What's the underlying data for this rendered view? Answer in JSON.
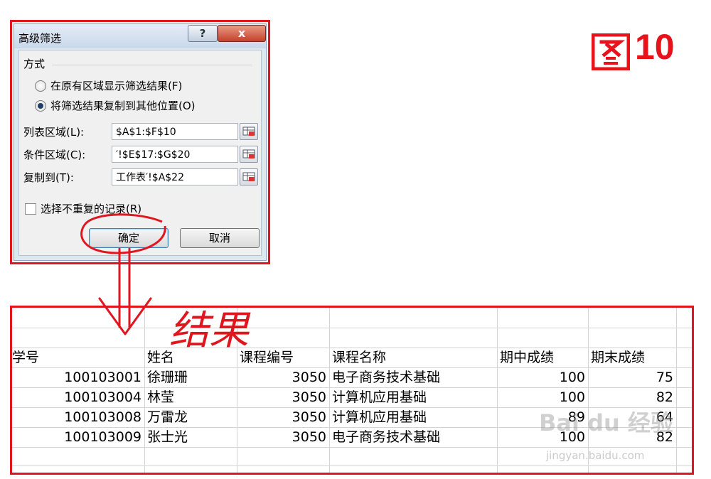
{
  "dialog": {
    "title": "高级筛选",
    "help_label": "?",
    "close_label": "x",
    "group_label": "方式",
    "radio_in_place": "在原有区域显示筛选结果(F)",
    "radio_copy": "将筛选结果复制到其他位置(O)",
    "list_range_label": "列表区域(L):",
    "list_range_value": "$A$1:$F$10",
    "criteria_range_label": "条件区域(C):",
    "criteria_range_value": "′!$E$17:$G$20",
    "copy_to_label": "复制到(T):",
    "copy_to_value": "工作表′!$A$22",
    "unique_label": "选择不重复的记录(R)",
    "ok_label": "确定",
    "cancel_label": "取消"
  },
  "figure": {
    "logo_char": "图",
    "number": "10"
  },
  "annotation": {
    "handwritten": "结果"
  },
  "sheet": {
    "headers": [
      "学号",
      "姓名",
      "课程编号",
      "课程名称",
      "期中成绩",
      "期末成绩"
    ],
    "rows": [
      [
        "100103001",
        "徐珊珊",
        "3050",
        "电子商务技术基础",
        "100",
        "75"
      ],
      [
        "100103004",
        "林莹",
        "3050",
        "计算机应用基础",
        "100",
        "82"
      ],
      [
        "100103008",
        "万雷龙",
        "3050",
        "计算机应用基础",
        "89",
        "64"
      ],
      [
        "100103009",
        "张士光",
        "3050",
        "电子商务技术基础",
        "100",
        "82"
      ]
    ]
  },
  "watermark": {
    "brand": "Bai du 经验",
    "url": "jingyan.baidu.com"
  },
  "colors": {
    "accent_red": "#e0161e",
    "dialog_bg": "#f0f0f0"
  }
}
